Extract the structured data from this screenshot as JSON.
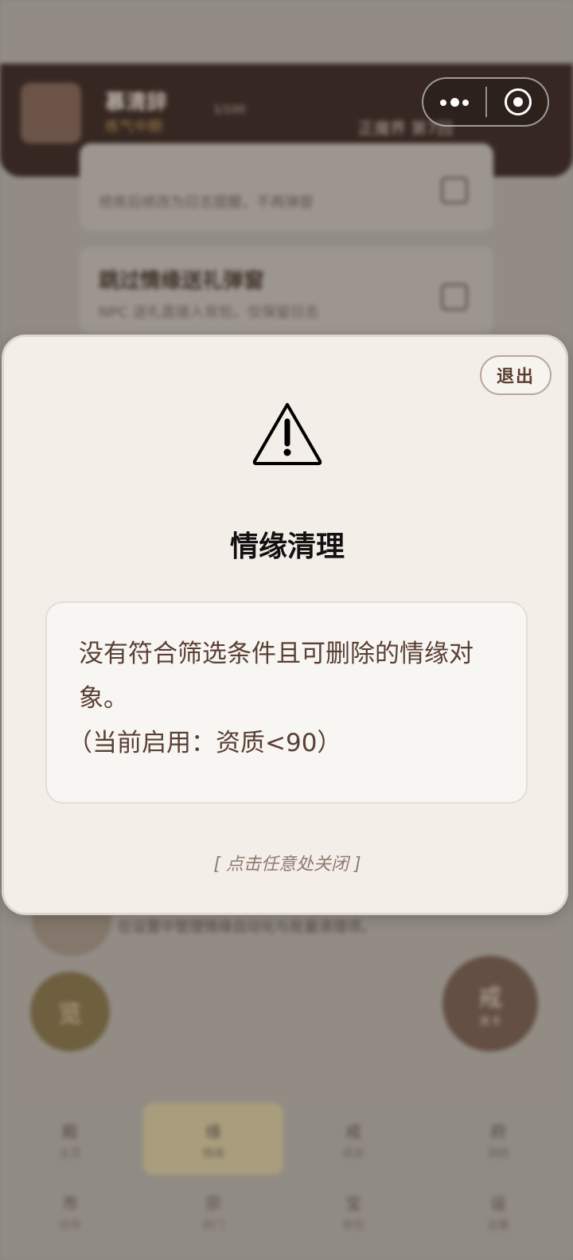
{
  "background": {
    "player_name": "慕清辞",
    "player_status": "练气中期",
    "chip_text": "1/100",
    "header_right": "正魔界 第7回",
    "cards": [
      {
        "title": "",
        "desc": "修炼后修改为日志提醒，不再弹窗"
      },
      {
        "title": "跳过情缘送礼弹窗",
        "desc": "NPC 送礼直接入背包，仅保留日志"
      }
    ],
    "note_text": "在设置中管理情缘自动化与批量清理项。",
    "left_fab": "览",
    "right_fab": {
      "label": "戒",
      "sub": "关卡"
    },
    "tabs": [
      {
        "icon": "殿",
        "label": "主页"
      },
      {
        "icon": "缘",
        "label": "情缘"
      },
      {
        "icon": "戒",
        "label": "闭关"
      },
      {
        "icon": "府",
        "label": "洞府"
      },
      {
        "icon": "市",
        "label": "坊市"
      },
      {
        "icon": "宗",
        "label": "宗门"
      },
      {
        "icon": "宝",
        "label": "背包"
      },
      {
        "icon": "设",
        "label": "设置"
      }
    ]
  },
  "modal": {
    "exit_label": "退出",
    "icon": "warning-triangle-icon",
    "title": "情缘清理",
    "message": "没有符合筛选条件且可删除的情缘对象。",
    "filter_note": "（当前启用：资质<90）",
    "close_hint": "[ 点击任意处关闭 ]"
  },
  "colors": {
    "modal_bg": "#f3eee8",
    "header_bg": "#2a1712",
    "text_brown": "#5a3f33"
  }
}
